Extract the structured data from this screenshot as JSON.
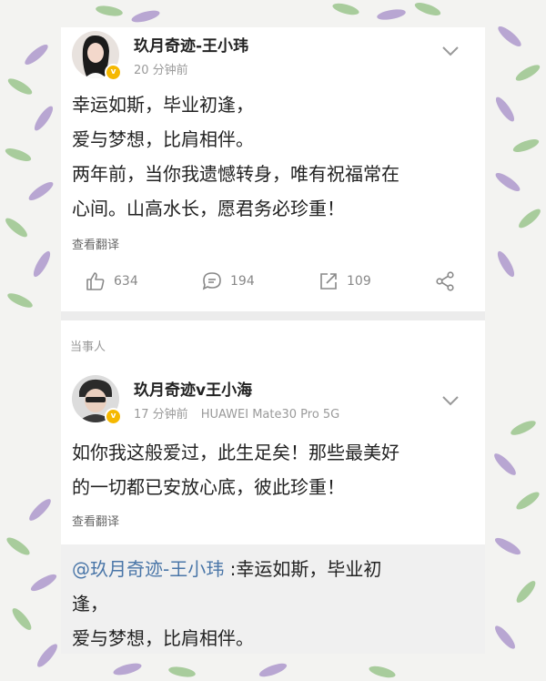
{
  "post1": {
    "author": "玖月奇迹-王小玮",
    "time": "20 分钟前",
    "lines": [
      "幸运如斯，毕业初逢，",
      "爱与梦想，比肩相伴。",
      "两年前，当你我遗憾转身，唯有祝福常在",
      "心间。山高水长，愿君务必珍重！"
    ],
    "translate_label": "查看翻译",
    "actions": {
      "likes": "634",
      "comments": "194",
      "reposts": "109"
    }
  },
  "section_label": "当事人",
  "post2": {
    "author": "玖月奇迹v王小海",
    "time": "17 分钟前",
    "device": "HUAWEI Mate30 Pro 5G",
    "lines": [
      "如你我这般爱过，此生足矣！那些最美好",
      "的一切都已安放心底，彼此珍重！"
    ],
    "translate_label": "查看翻译"
  },
  "quote": {
    "mention": "@玖月奇迹-王小玮",
    "line1_rest": " :幸运如斯，毕业初",
    "line2": "逢，",
    "line3": "爱与梦想，比肩相伴。"
  },
  "colors": {
    "leaf_purple": "#a48cc7",
    "leaf_green": "#8fbf7f",
    "verified": "#f5b800",
    "mention": "#4a76a8"
  },
  "icons": [
    "like-icon",
    "comment-icon",
    "repost-icon",
    "share-icon",
    "chevron-down-icon",
    "verified-badge-icon"
  ]
}
